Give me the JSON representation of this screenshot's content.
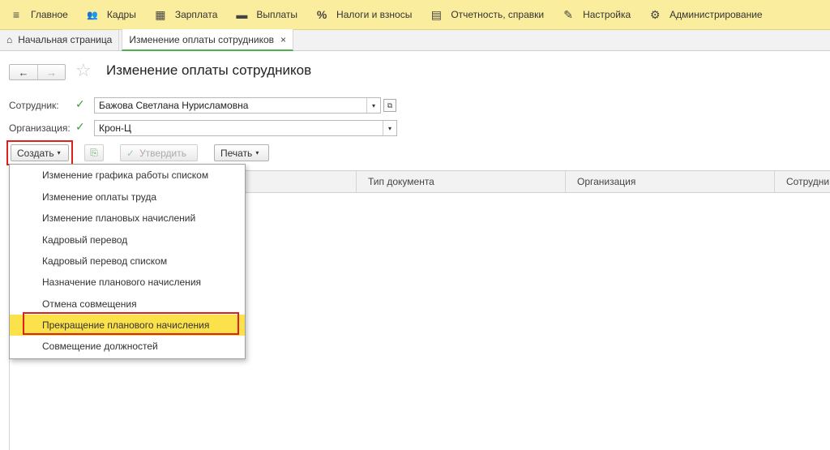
{
  "menu": [
    {
      "icon": "hamburger-menu-icon",
      "glyph": "≡",
      "label": "Главное"
    },
    {
      "icon": "people-icon",
      "glyph": "👥",
      "label": "Кадры"
    },
    {
      "icon": "calculator-icon",
      "glyph": "▦",
      "label": "Зарплата"
    },
    {
      "icon": "wallet-icon",
      "glyph": "▬",
      "label": "Выплаты"
    },
    {
      "icon": "percent-icon",
      "glyph": "%",
      "label": "Налоги и взносы"
    },
    {
      "icon": "documents-icon",
      "glyph": "▤",
      "label": "Отчетность, справки"
    },
    {
      "icon": "wrench-icon",
      "glyph": "✎",
      "label": "Настройка"
    },
    {
      "icon": "gear-icon",
      "glyph": "⚙",
      "label": "Администрирование"
    }
  ],
  "tabs": {
    "home": "Начальная страница",
    "active": "Изменение оплаты сотрудников",
    "close_glyph": "×",
    "home_glyph": "⌂"
  },
  "nav": {
    "back": "←",
    "forward": "→",
    "star": "☆"
  },
  "page": {
    "title": "Изменение оплаты сотрудников"
  },
  "form": {
    "employee_label": "Сотрудник:",
    "employee_value": "Бажова Светлана Нурисламовна",
    "org_label": "Организация:",
    "org_value": "Крон-Ц",
    "check_glyph": "✓",
    "dropdown_glyph": "▾",
    "open_glyph": "⧉"
  },
  "toolbar": {
    "create": "Создать",
    "approve": "Утвердить",
    "print": "Печать",
    "arrow": "▾",
    "approve_glyph": "✓",
    "copy_glyph": "⎘"
  },
  "table": {
    "columns": [
      "",
      "Тип документа",
      "Организация",
      "Сотрудни"
    ]
  },
  "create_menu": [
    "Изменение графика работы списком",
    "Изменение оплаты труда",
    "Изменение плановых начислений",
    "Кадровый перевод",
    "Кадровый перевод списком",
    "Назначение планового начисления",
    "Отмена совмещения",
    "Прекращение планового начисления",
    "Совмещение должностей"
  ],
  "highlighted_item": "Прекращение планового начисления",
  "colors": {
    "accent": "#fbed9e",
    "highlight": "#fbe14a",
    "marker": "#e0201a",
    "check": "#3a9d3a"
  }
}
